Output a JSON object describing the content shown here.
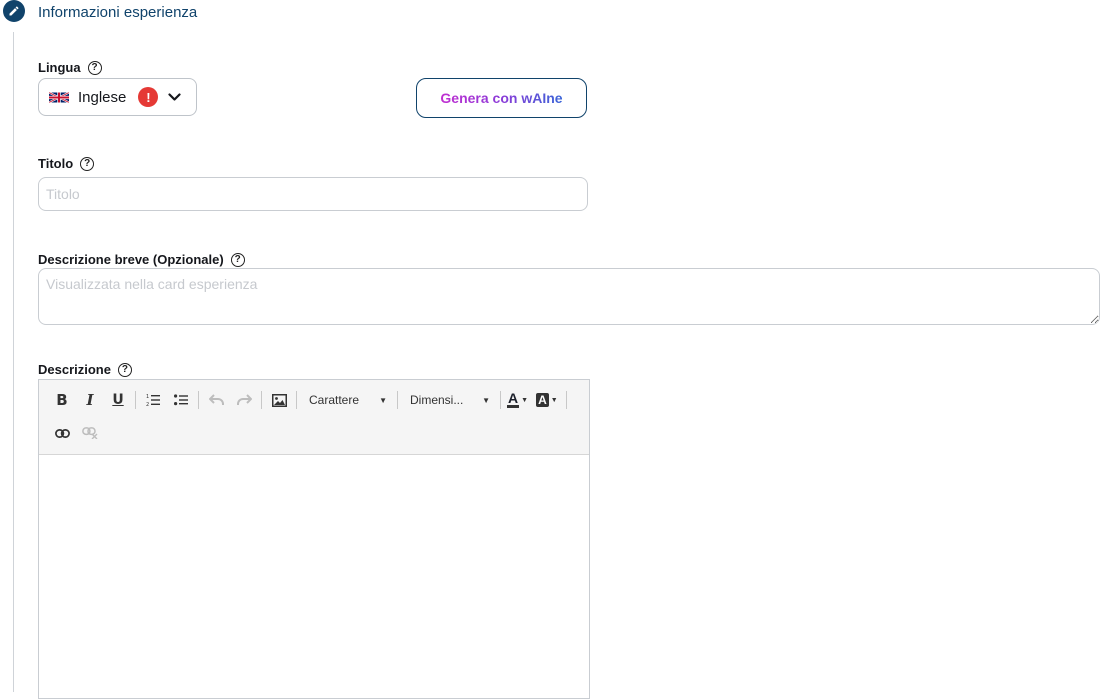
{
  "section": {
    "title": "Informazioni esperienza",
    "icon": "pencil-icon"
  },
  "language": {
    "label": "Lingua",
    "selected": "Inglese",
    "flag_icon": "uk-flag-icon",
    "alert_symbol": "!",
    "alert_color": "#e53935"
  },
  "generate_button": {
    "label": "Genera con wAIne"
  },
  "title_field": {
    "label": "Titolo",
    "placeholder": "Titolo",
    "value": ""
  },
  "short_description": {
    "label": "Descrizione breve (Opzionale)",
    "placeholder": "Visualizzata nella card esperienza",
    "value": ""
  },
  "description": {
    "label": "Descrizione",
    "toolbar": {
      "bold": "B",
      "italic": "I",
      "underline": "U",
      "font_dropdown": "Carattere",
      "size_dropdown": "Dimensi...",
      "font_color_glyph": "A",
      "bg_color_glyph": "A"
    },
    "content": ""
  },
  "help_symbol": "?",
  "colors": {
    "brand": "#10436b",
    "border": "#c9cdd2",
    "gradient_start": "#c12fd1",
    "gradient_end": "#3a66d8"
  }
}
